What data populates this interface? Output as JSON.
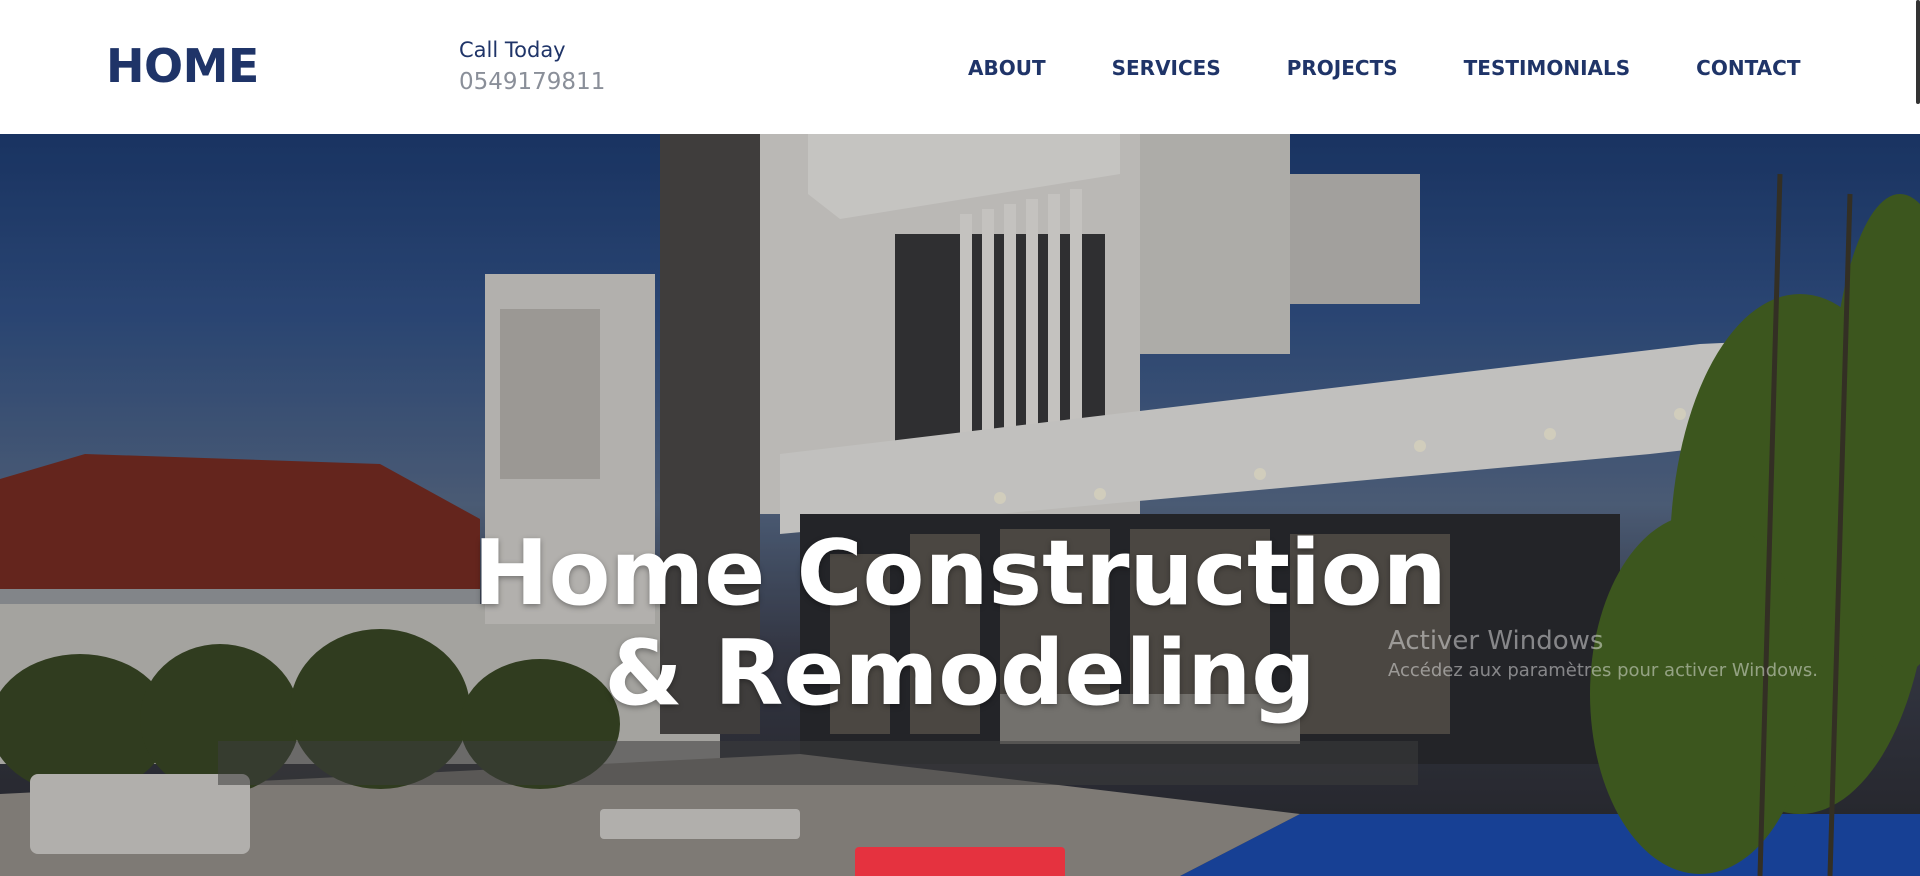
{
  "header": {
    "logo": "HOME",
    "call_label": "Call Today",
    "phone": "0549179811",
    "nav": [
      "ABOUT",
      "SERVICES",
      "PROJECTS",
      "TESTIMONIALS",
      "CONTACT"
    ]
  },
  "hero": {
    "title_line1": "Home Construction",
    "title_line2": "& Remodeling",
    "cta_label": ""
  },
  "watermark": {
    "title": "Activer Windows",
    "subtitle": "Accédez aux paramètres pour activer Windows."
  },
  "colors": {
    "brand_navy": "#1f3468",
    "phone_gray": "#8a8f99",
    "cta_red": "#e5323f"
  }
}
